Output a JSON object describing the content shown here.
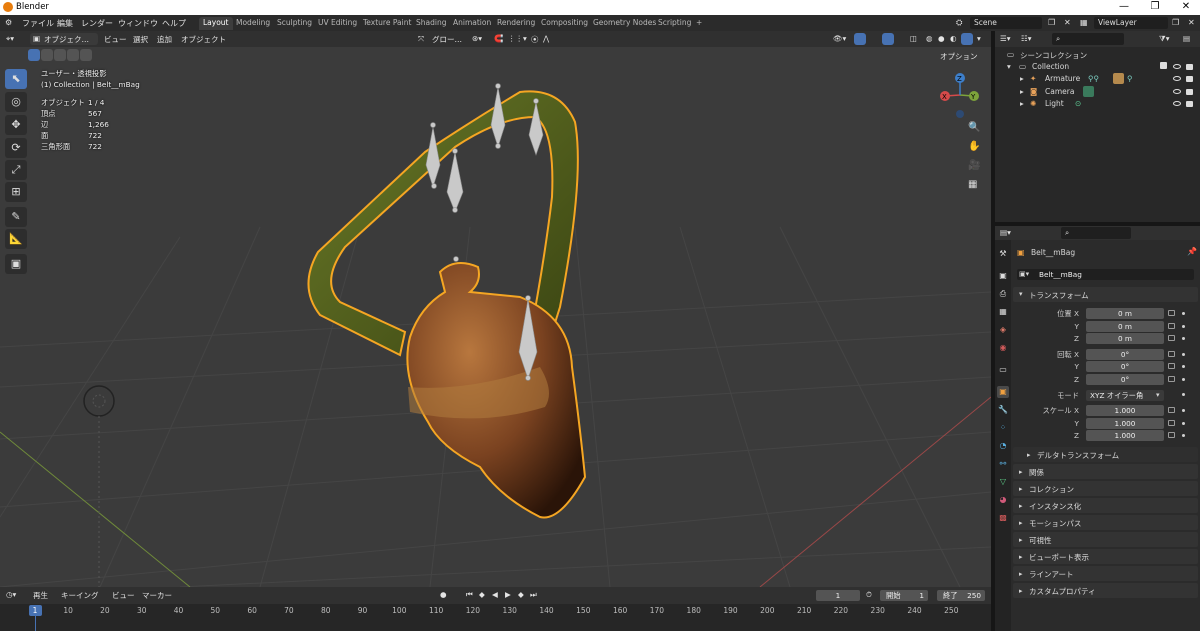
{
  "window": {
    "title": "Blender",
    "min": "—",
    "max": "❐",
    "close": "✕"
  },
  "menu": {
    "file": "ファイル",
    "edit": "編集",
    "render": "レンダー",
    "window": "ウィンドウ",
    "help": "ヘルプ"
  },
  "workspaces": [
    "Layout",
    "Modeling",
    "Sculpting",
    "UV Editing",
    "Texture Paint",
    "Shading",
    "Animation",
    "Rendering",
    "Compositing",
    "Geometry Nodes",
    "Scripting"
  ],
  "workspace_add": "+",
  "scene": {
    "name": "Scene",
    "view_layer": "ViewLayer"
  },
  "viewport_header": {
    "mode": "オブジェク…",
    "view": "ビュー",
    "select": "選択",
    "add": "追加",
    "object": "オブジェクト",
    "transform_orient": "グロー…",
    "options": "オプション"
  },
  "viewport_info": {
    "view_name": "ユーザー・透視投影",
    "collection": "(1) Collection | Belt__mBag",
    "stats": [
      {
        "label": "オブジェクト",
        "value": "1 / 4"
      },
      {
        "label": "頂点",
        "value": "567"
      },
      {
        "label": "辺",
        "value": "1,266"
      },
      {
        "label": "面",
        "value": "722"
      },
      {
        "label": "三角形面",
        "value": "722"
      }
    ]
  },
  "gizmo": {
    "x": "X",
    "y": "Y",
    "z": "Z"
  },
  "timeline": {
    "playback": "再生",
    "keying": "キーイング",
    "view": "ビュー",
    "marker": "マーカー",
    "current_frame": "1",
    "start_label": "開始",
    "start": "1",
    "end_label": "終了",
    "end": "250",
    "ticks": [
      "1",
      "10",
      "20",
      "30",
      "40",
      "50",
      "60",
      "70",
      "80",
      "90",
      "100",
      "110",
      "120",
      "130",
      "140",
      "150",
      "160",
      "170",
      "180",
      "190",
      "200",
      "210",
      "220",
      "230",
      "240",
      "250"
    ]
  },
  "outliner": {
    "root": "シーンコレクション",
    "collection": "Collection",
    "items": [
      "Armature",
      "Camera",
      "Light"
    ]
  },
  "properties": {
    "object_name": "Belt__mBag",
    "data_name": "Belt__mBag",
    "transform_panel": "トランスフォーム",
    "location_label": "位置 X",
    "rotation_label": "回転 X",
    "scale_label": "スケール X",
    "y": "Y",
    "z": "Z",
    "location": [
      "0 m",
      "0 m",
      "0 m"
    ],
    "rotation": [
      "0°",
      "0°",
      "0°"
    ],
    "mode_label": "モード",
    "mode_value": "XYZ オイラー角",
    "scale": [
      "1.000",
      "1.000",
      "1.000"
    ],
    "delta": "デルタトランスフォーム",
    "panels": [
      "関係",
      "コレクション",
      "インスタンス化",
      "モーションパス",
      "可視性",
      "ビューポート表示",
      "ラインアート",
      "カスタムプロパティ"
    ]
  },
  "colors": {
    "accent": "#4772b3",
    "selection": "#f5a623",
    "bag_brown": "#7a4220",
    "strap_green": "#5a6a1c"
  }
}
